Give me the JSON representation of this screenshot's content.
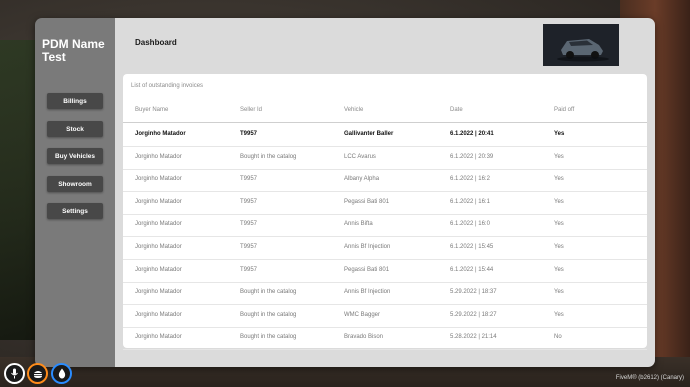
{
  "overlay": {
    "fps_text": "",
    "recording_text": "",
    "status_text": "",
    "fivem_text": "FiveM® (b2612) (Canary)"
  },
  "brand": {
    "title": "PDM Name Test"
  },
  "nav": [
    {
      "label": "Billings"
    },
    {
      "label": "Stock"
    },
    {
      "label": "Buy Vehicles"
    },
    {
      "label": "Showroom"
    },
    {
      "label": "Settings"
    }
  ],
  "header": {
    "title": "Dashboard"
  },
  "invoices": {
    "title": "List of outstanding invoices",
    "columns": [
      "Buyer Name",
      "Seller Id",
      "Vehicle",
      "Date",
      "Paid off"
    ],
    "rows": [
      [
        "Jorginho Matador",
        "T9957",
        "Gallivanter Baller",
        "6.1.2022 | 20:41",
        "Yes"
      ],
      [
        "Jorginho Matador",
        "Bought in the catalog",
        "LCC Avarus",
        "6.1.2022 | 20:39",
        "Yes"
      ],
      [
        "Jorginho Matador",
        "T9957",
        "Albany Alpha",
        "6.1.2022 | 16:2",
        "Yes"
      ],
      [
        "Jorginho Matador",
        "T9957",
        "Pegassi Bati 801",
        "6.1.2022 | 16:1",
        "Yes"
      ],
      [
        "Jorginho Matador",
        "T9957",
        "Annis Bifta",
        "6.1.2022 | 16:0",
        "Yes"
      ],
      [
        "Jorginho Matador",
        "T9957",
        "Annis Bf Injection",
        "6.1.2022 | 15:45",
        "Yes"
      ],
      [
        "Jorginho Matador",
        "T9957",
        "Pegassi Bati 801",
        "6.1.2022 | 15:44",
        "Yes"
      ],
      [
        "Jorginho Matador",
        "Bought in the catalog",
        "Annis Bf Injection",
        "5.29.2022 | 18:37",
        "Yes"
      ],
      [
        "Jorginho Matador",
        "Bought in the catalog",
        "WMC Bagger",
        "5.29.2022 | 18:27",
        "Yes"
      ],
      [
        "Jorginho Matador",
        "Bought in the catalog",
        "Bravado Bison",
        "5.28.2022 | 21:14",
        "No"
      ]
    ]
  },
  "hud": [
    {
      "icon": "microphone-icon",
      "ring": "#ffffff"
    },
    {
      "icon": "food-icon",
      "ring": "#ff8c1a"
    },
    {
      "icon": "water-drop-icon",
      "ring": "#2a8cff"
    }
  ],
  "colors": {
    "sidebar": "#7a7a7a",
    "nav_button": "#484848",
    "main_bg": "#dbdbdb",
    "panel_bg": "#ffffff"
  }
}
